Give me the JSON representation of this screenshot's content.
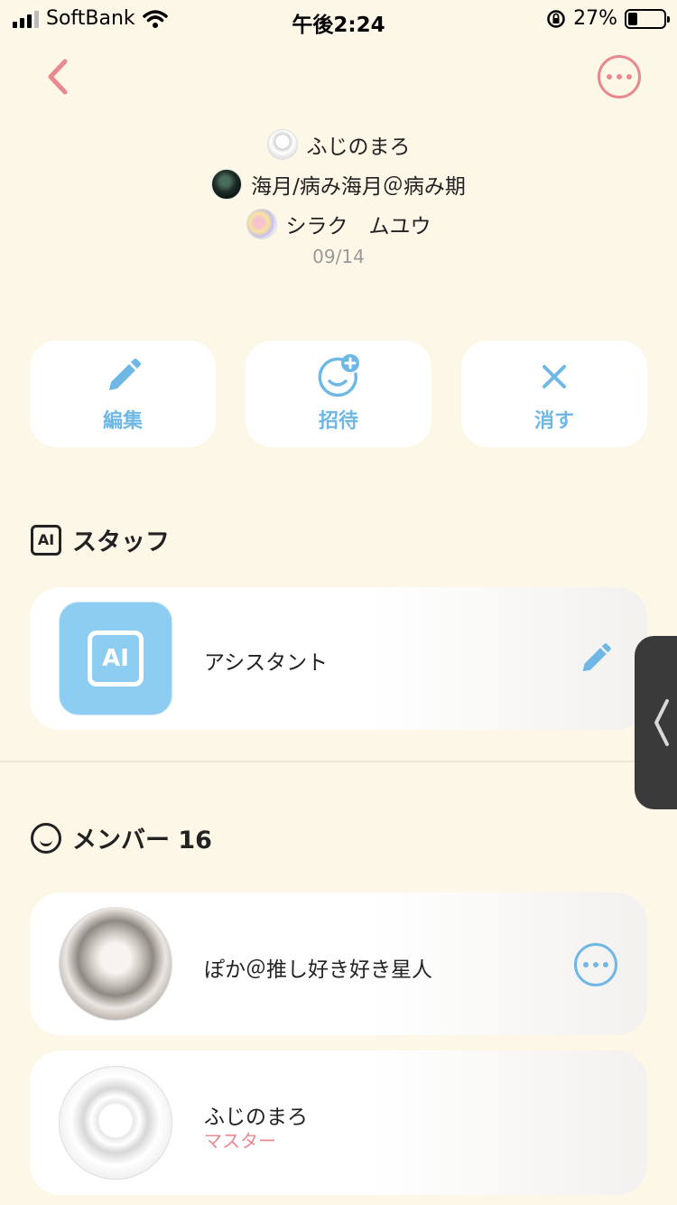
{
  "status_bar": {
    "carrier": "SoftBank",
    "time": "午後2:24",
    "battery_percent": "27%",
    "battery_level": 0.27
  },
  "participants": [
    {
      "name": "ふじのまろ"
    },
    {
      "name": "海月/病み海月＠病み期"
    },
    {
      "name": "シラク　ムユウ"
    }
  ],
  "date": "09/14",
  "actions": {
    "edit": "編集",
    "invite": "招待",
    "delete": "消す"
  },
  "staff_section": {
    "badge": "AI",
    "title": "スタッフ",
    "items": [
      {
        "tile_text": "AI",
        "name": "アシスタント"
      }
    ]
  },
  "member_section": {
    "title": "メンバー 16",
    "items": [
      {
        "name": "ぽか＠推し好き好き星人"
      },
      {
        "name": "ふじのまろ",
        "role": "マスター"
      }
    ]
  },
  "colors": {
    "background": "#FDF7E7",
    "accent_pink": "#E8898F",
    "accent_blue": "#6FB8E6",
    "ai_tile": "#8ECDF2"
  },
  "icons": {
    "back": "chevron-left-icon",
    "more": "more-horizontal-icon",
    "edit": "pencil-icon",
    "invite": "add-face-icon",
    "delete": "close-icon",
    "members": "smile-icon",
    "handle": "chevron-left-icon"
  }
}
